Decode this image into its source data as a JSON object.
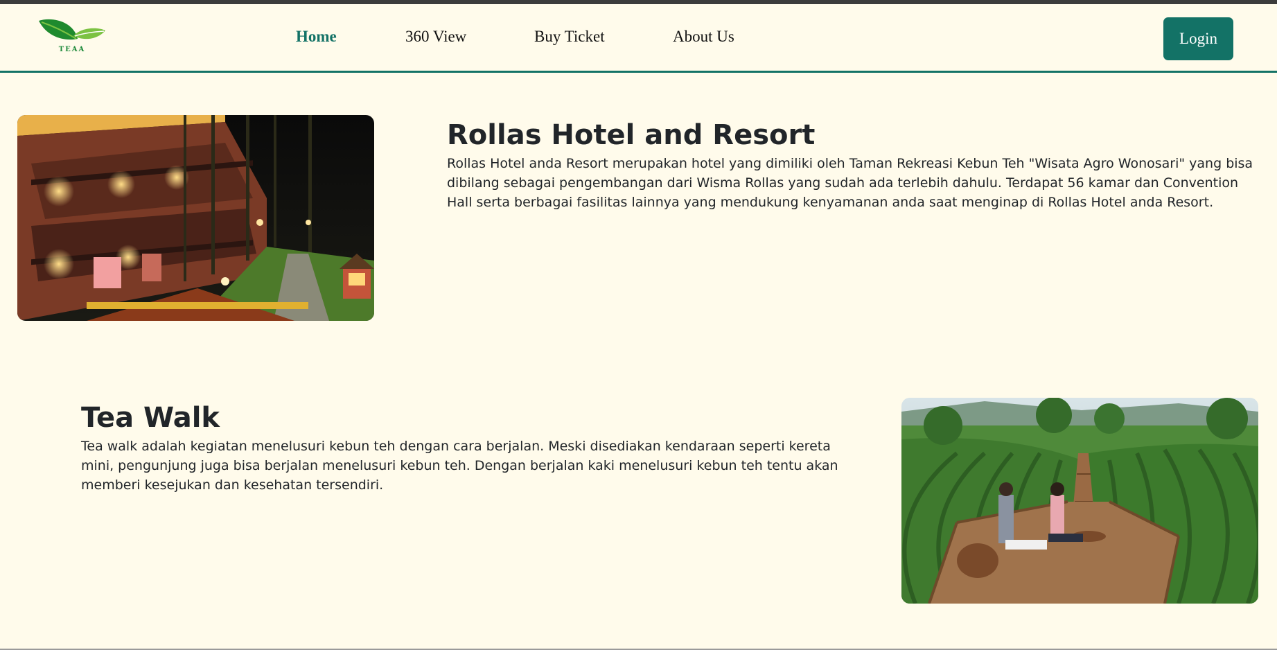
{
  "brand": {
    "logo_text": "TEAA",
    "colors": {
      "primary": "#137266",
      "background": "#fffbeb",
      "leaf_dark": "#1f8a2e",
      "leaf_light": "#7cc242"
    }
  },
  "nav": {
    "items": [
      {
        "label": "Home",
        "active": true
      },
      {
        "label": "360 View",
        "active": false
      },
      {
        "label": "Buy Ticket",
        "active": false
      },
      {
        "label": "About Us",
        "active": false
      }
    ],
    "login_label": "Login"
  },
  "sections": [
    {
      "title": "Rollas Hotel and Resort",
      "body": "Rollas Hotel anda Resort merupakan hotel yang dimiliki oleh Taman Rekreasi Kebun Teh \"Wisata Agro Wonosari\" yang bisa dibilang sebagai pengembangan dari Wisma Rollas yang sudah ada terlebih dahulu. Terdapat 56 kamar dan Convention Hall serta berbagai fasilitas lainnya yang mendukung kenyamanan anda saat menginap di Rollas Hotel anda Resort."
    },
    {
      "title": "Tea Walk",
      "body": "Tea walk adalah kegiatan menelusuri kebun teh dengan cara berjalan. Meski disediakan kendaraan seperti kereta mini, pengunjung juga bisa berjalan menelusuri kebun teh. Dengan berjalan kaki menelusuri kebun teh tentu akan memberi kesejukan dan kesehatan tersendiri."
    }
  ]
}
